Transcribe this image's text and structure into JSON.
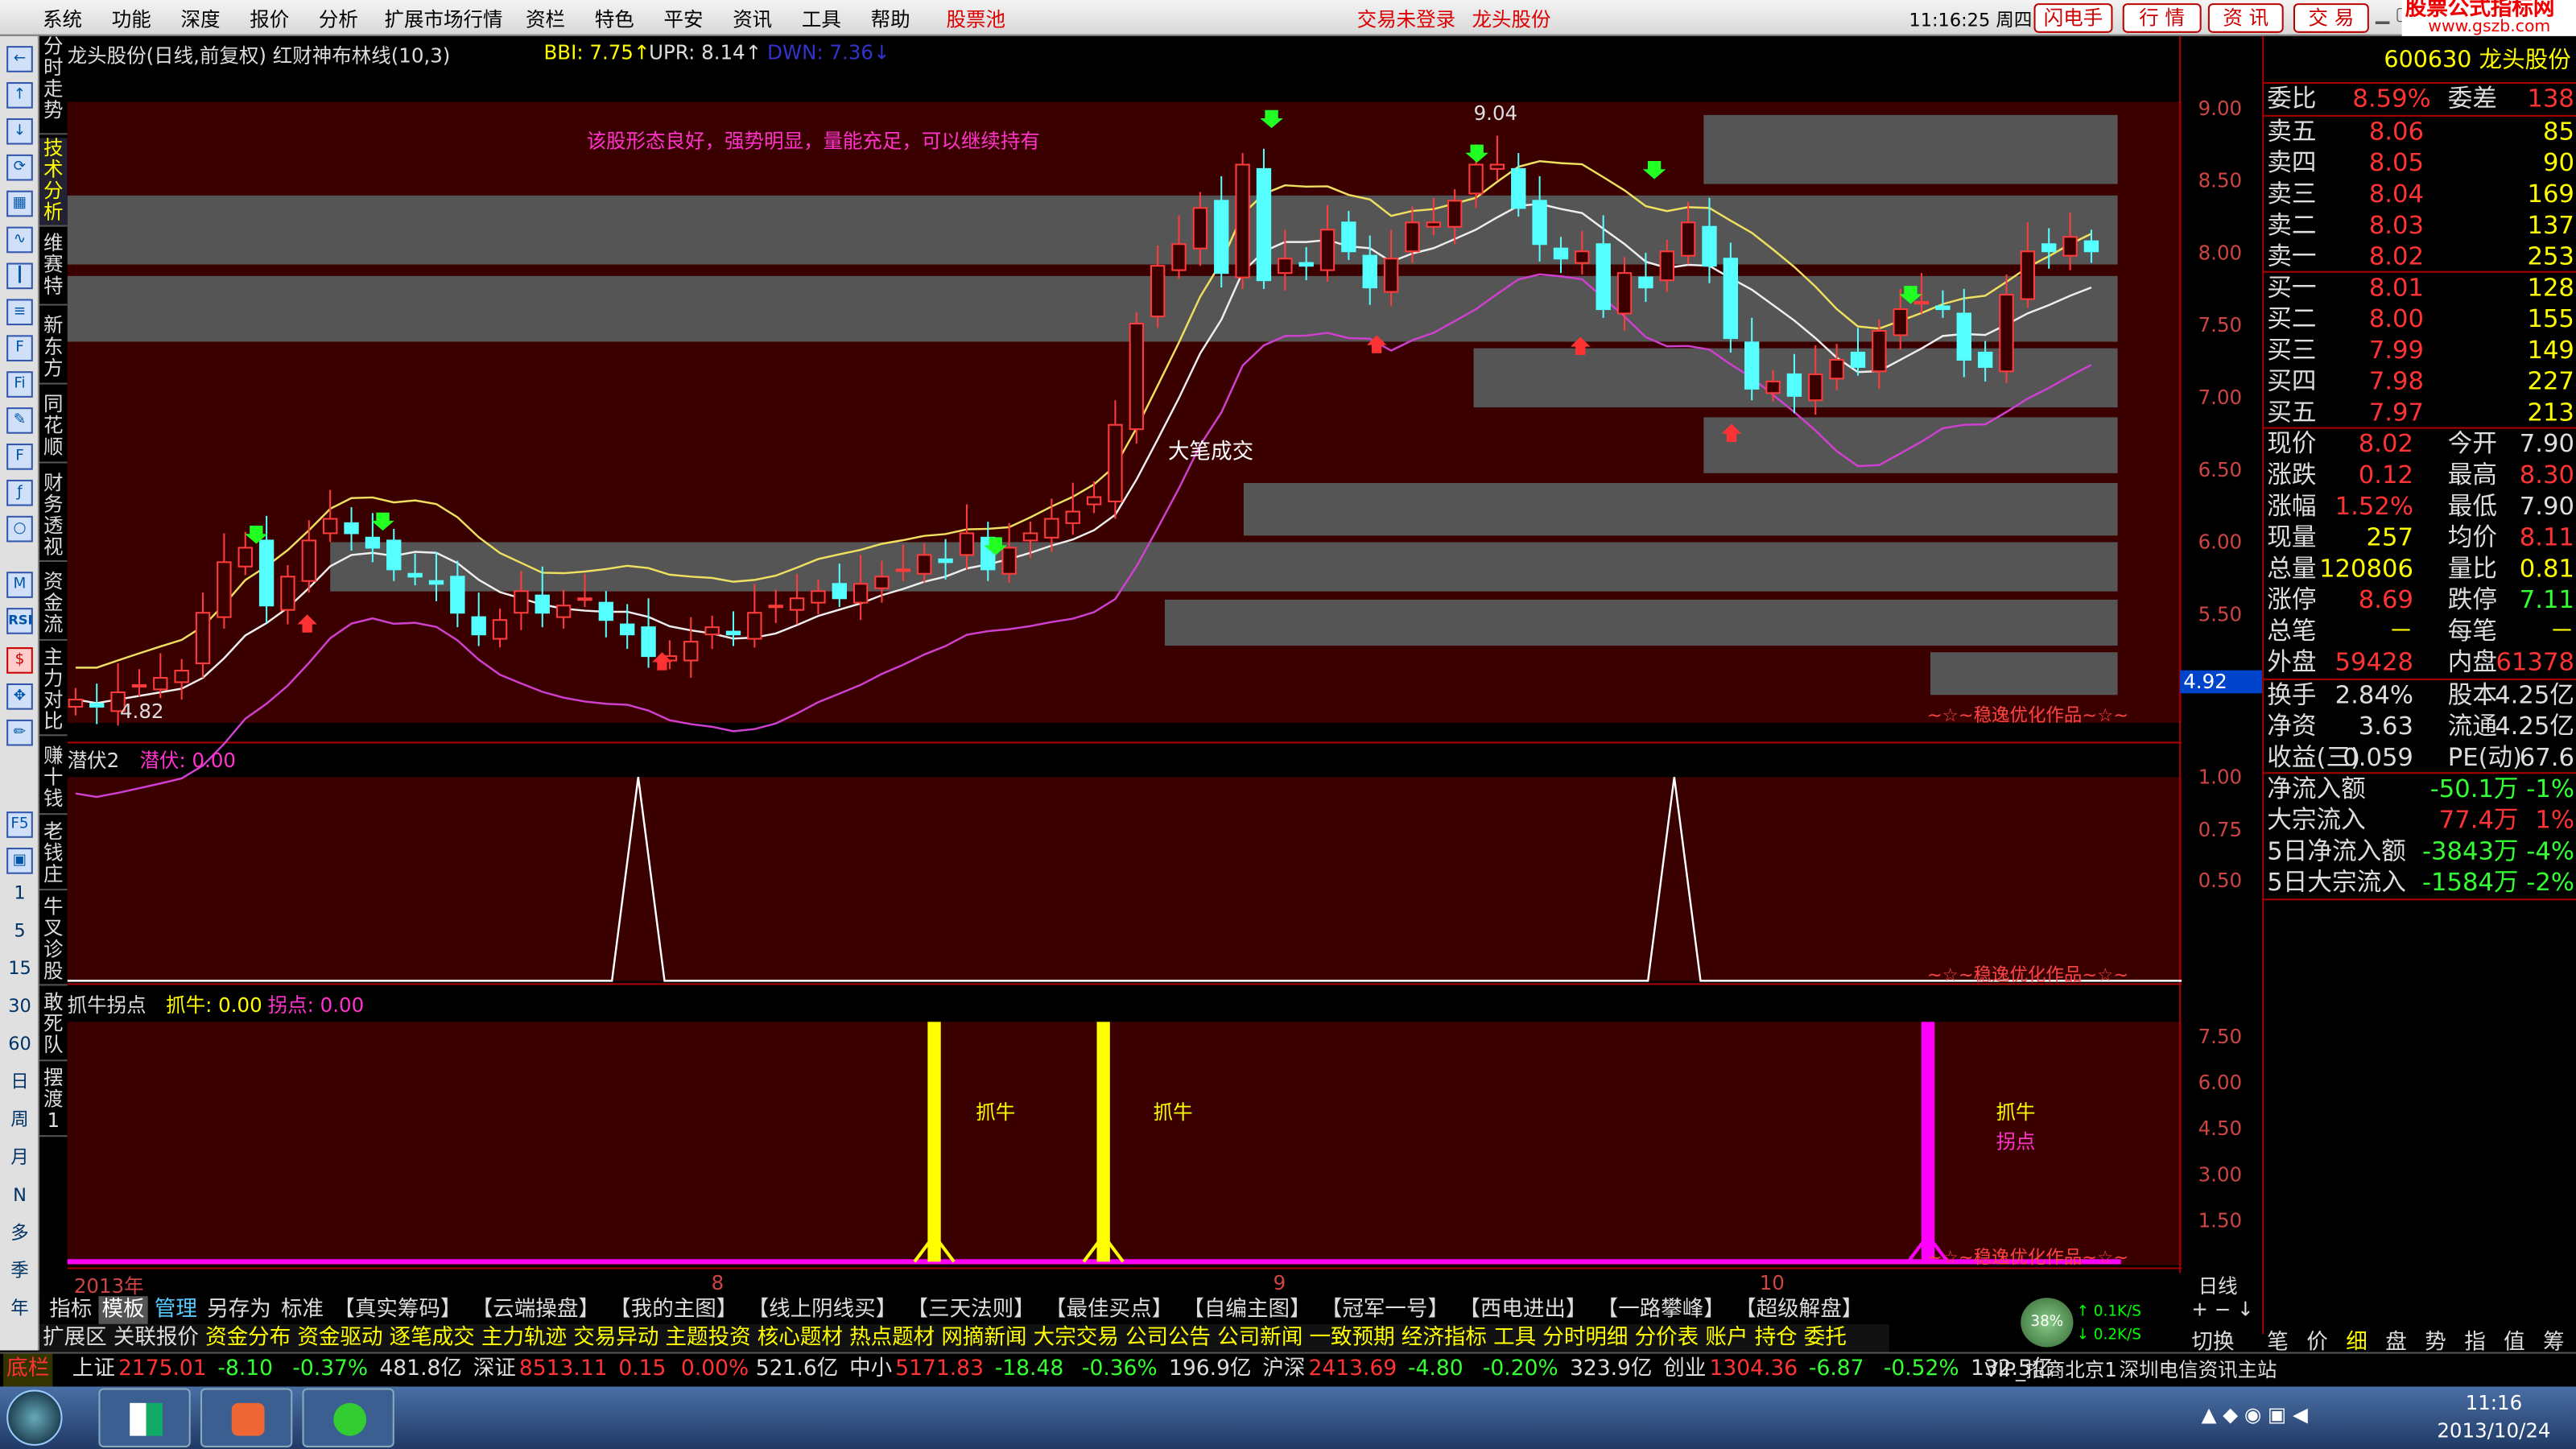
{
  "menu": {
    "items": [
      "系统",
      "功能",
      "深度",
      "报价",
      "分析",
      "扩展市场行情",
      "资栏",
      "特色",
      "平安",
      "资讯",
      "工具",
      "帮助"
    ],
    "pool": "股票池",
    "login_status": "交易未登录",
    "stock_link": "龙头股份",
    "time": "11:16:25 周四",
    "buttons": [
      "闪电手",
      "行 情",
      "资 讯",
      "交 易"
    ],
    "brand": "股票公式指标网",
    "brand_url": "www.gszb.com"
  },
  "chart": {
    "title": "龙头股份(日线,前复权) 红财神布林线(10,3)",
    "bbi": "BBI: 7.75↑",
    "upr": "UPR: 8.14↑",
    "dwn": "DWN: 7.36↓",
    "comment": "该股形态良好，强势明显，量能充足，可以继续持有",
    "big_order": "大笔成交",
    "high_label": "9.04",
    "low_label": "4.82",
    "credit": "~☆~稳逸优化作品~☆~",
    "price_axis": [
      "9.00",
      "8.50",
      "8.00",
      "7.50",
      "7.00",
      "6.50",
      "6.00",
      "5.50"
    ],
    "last_price_box": "4.92",
    "osc_title": "潜伏2",
    "osc_value": "潜伏: 0.00",
    "osc_axis": [
      "1.00",
      "0.75",
      "0.50"
    ],
    "sig_title": "抓牛拐点",
    "sig_value1": "抓牛: 0.00",
    "sig_value2": "拐点: 0.00",
    "sig_axis": [
      "7.50",
      "6.00",
      "4.50",
      "3.00",
      "1.50"
    ],
    "sig_labels": [
      "抓牛",
      "抓牛",
      "抓牛",
      "拐点"
    ],
    "date_labels": [
      "2013年",
      "8",
      "9",
      "10"
    ],
    "period": "日线"
  },
  "chart_data": [
    {
      "type": "candlestick",
      "title": "龙头股份(日线,前复权) 红财神布林线(10,3)",
      "ylim": [
        4.6,
        9.3
      ],
      "series": [
        {
          "name": "BBI",
          "last": 7.75
        },
        {
          "name": "UPR",
          "last": 8.14
        },
        {
          "name": "DWN",
          "last": 7.36
        }
      ],
      "annotations": [
        {
          "text": "9.04",
          "value": 9.04
        },
        {
          "text": "4.82",
          "value": 4.82
        },
        {
          "text": "大笔成交"
        }
      ]
    },
    {
      "type": "line",
      "title": "潜伏2",
      "ylim": [
        0,
        1.1
      ],
      "series": [
        {
          "name": "潜伏",
          "peaks_x_fraction": [
            0.27,
            0.76
          ],
          "peak_value": 1.0
        }
      ]
    },
    {
      "type": "bar",
      "title": "抓牛拐点",
      "ylim": [
        0,
        8
      ],
      "series": [
        {
          "name": "抓牛",
          "bars": [
            {
              "x": 0.41,
              "value": 8
            },
            {
              "x": 0.49,
              "value": 8
            }
          ]
        },
        {
          "name": "拐点",
          "bars": [
            {
              "x": 0.88,
              "value": 8
            }
          ]
        }
      ]
    }
  ],
  "quote": {
    "code_name": "600630 龙头股份",
    "weibi_label": "委比",
    "weibi_val": "8.59%",
    "weicha_label": "委差",
    "weicha_val": "138",
    "sell": [
      [
        "卖五",
        "8.06",
        "85"
      ],
      [
        "卖四",
        "8.05",
        "90"
      ],
      [
        "卖三",
        "8.04",
        "169"
      ],
      [
        "卖二",
        "8.03",
        "137"
      ],
      [
        "卖一",
        "8.02",
        "253"
      ]
    ],
    "buy": [
      [
        "买一",
        "8.01",
        "128"
      ],
      [
        "买二",
        "8.00",
        "155"
      ],
      [
        "买三",
        "7.99",
        "149"
      ],
      [
        "买四",
        "7.98",
        "227"
      ],
      [
        "买五",
        "7.97",
        "213"
      ]
    ],
    "stats": [
      [
        "现价",
        "8.02",
        "今开",
        "7.90"
      ],
      [
        "涨跌",
        "0.12",
        "最高",
        "8.30"
      ],
      [
        "涨幅",
        "1.52%",
        "最低",
        "7.90"
      ],
      [
        "现量",
        "257",
        "均价",
        "8.11"
      ],
      [
        "总量",
        "120806",
        "量比",
        "0.81"
      ],
      [
        "涨停",
        "8.69",
        "跌停",
        "7.11"
      ],
      [
        "总笔",
        "－",
        "每笔",
        "－"
      ],
      [
        "外盘",
        "59428",
        "内盘",
        "61378"
      ]
    ],
    "stats2": [
      [
        "换手",
        "2.84%",
        "股本",
        "4.25亿"
      ],
      [
        "净资",
        "3.63",
        "流通",
        "4.25亿"
      ],
      [
        "收益(三)",
        "0.059",
        "PE(动)",
        "67.6"
      ]
    ],
    "flows": [
      [
        "净流入额",
        "-50.1万",
        "-1%"
      ],
      [
        "大宗流入",
        "77.4万",
        "1%"
      ],
      [
        "5日净流入额",
        "-3843万",
        "-4%"
      ],
      [
        "5日大宗流入",
        "-1584万",
        "-2%"
      ]
    ],
    "bottom_tabs": [
      "笔",
      "价",
      "细",
      "盘",
      "势",
      "指",
      "值",
      "筹"
    ]
  },
  "tabs_row1": [
    "指标",
    "模板",
    "管理",
    "另存为",
    "标准",
    "【真实筹码】",
    "【云端操盘】",
    "【我的主图】",
    "【线上阴线买】",
    "【三天法则】",
    "【最佳买点】",
    "【自编主图】",
    "【冠军一号】",
    "【西电进出】",
    "【一路攀峰】",
    "【超级解盘】"
  ],
  "tabs_row2": [
    "扩展区",
    "关联报价",
    "资金分布",
    "资金驱动",
    "逐笔成交",
    "主力轨迹",
    "交易异动",
    "主题投资",
    "核心题材",
    "热点题材",
    "网摘新闻",
    "大宗交易",
    "公司公告",
    "公司新闻",
    "一致预期",
    "经济指标",
    "工具",
    "分时明细",
    "分价表",
    "账户",
    "持仓",
    "委托"
  ],
  "speed": {
    "pct": "38%",
    "up": "0.1K/S",
    "down": "0.2K/S"
  },
  "side_tabs": [
    "分时走势",
    "技术分析",
    "维赛特",
    "新东方",
    "同花顺",
    "财务透视",
    "资金流",
    "主力对比",
    "赚十钱",
    "老钱庄",
    "牛叉诊股",
    "敢死队",
    "摆渡1"
  ],
  "period_buttons": [
    "1",
    "5",
    "15",
    "30",
    "60",
    "日",
    "周",
    "月",
    "N",
    "多",
    "季",
    "年"
  ],
  "ticker": {
    "label": "底栏",
    "items": [
      [
        "上证",
        "2175.01",
        "-8.10",
        "-0.37%",
        "481.8亿"
      ],
      [
        "深证",
        "8513.11",
        "0.15",
        "0.00%",
        "521.6亿"
      ],
      [
        "中小",
        "5171.83",
        "-18.48",
        "-0.36%",
        "196.9亿"
      ],
      [
        "沪深",
        "2413.69",
        "-4.80",
        "-0.20%",
        "323.9亿"
      ],
      [
        "创业",
        "1304.36",
        "-6.87",
        "-0.52%",
        "132.5亿"
      ]
    ],
    "vip": "VIP_招商北京1",
    "site": "深圳电信资讯主站"
  },
  "taskbar": {
    "time": "11:16",
    "date": "2013/10/24"
  },
  "switch_label": "切换"
}
